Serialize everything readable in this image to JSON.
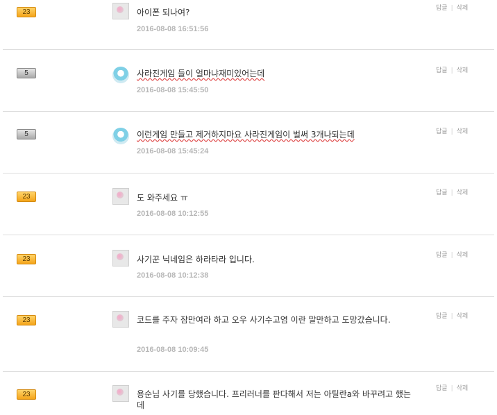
{
  "comments": [
    {
      "badge": "23",
      "badge_style": "gold",
      "avatar": "pink",
      "text": "아이폰 되나여?",
      "date": "2016-08-08 16:51:56",
      "reply": "답글",
      "delete": "삭제"
    },
    {
      "badge": "5",
      "badge_style": "gray",
      "avatar": "gem",
      "text": "사라진게임 들이 얼마냐재미있어는데",
      "date": "2016-08-08 15:45:50",
      "reply": "답글",
      "delete": "삭제"
    },
    {
      "badge": "5",
      "badge_style": "gray",
      "avatar": "gem",
      "text": "이런게임 만들고 제거하지마요 사라진게임이 벌써 3개나되는데",
      "date": "2016-08-08 15:45:24",
      "reply": "답글",
      "delete": "삭제"
    },
    {
      "badge": "23",
      "badge_style": "gold",
      "avatar": "pink",
      "text": "도 와주세요 ㅠ",
      "date": "2016-08-08 10:12:55",
      "reply": "답글",
      "delete": "삭제"
    },
    {
      "badge": "23",
      "badge_style": "gold",
      "avatar": "pink",
      "text": "사기꾼 닉네임은 하라타라 입니다.",
      "date": "2016-08-08 10:12:38",
      "reply": "답글",
      "delete": "삭제"
    },
    {
      "badge": "23",
      "badge_style": "gold",
      "avatar": "pink",
      "text": "코드를 주자 잠만여라 하고 오우 사기수고염 이란 말만하고 도망갔습니다.",
      "date": "2016-08-08 10:09:45",
      "reply": "답글",
      "delete": "삭제"
    },
    {
      "badge": "23",
      "badge_style": "gold",
      "avatar": "pink",
      "text": "용순님 사기를 당했습니다. 프리러너를 판다해서 저는 아틸란a와 바꾸려고 했는데",
      "date": "",
      "reply": "답글",
      "delete": "삭제"
    }
  ]
}
